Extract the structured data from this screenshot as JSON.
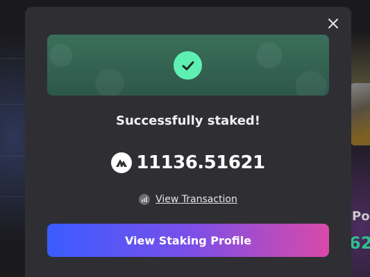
{
  "background": {
    "right_label": "Po",
    "right_value": "62"
  },
  "modal": {
    "close_icon": "close-icon",
    "banner_icon": "check-circle-icon",
    "title": "Successfully staked!",
    "amount": "11136.51621",
    "token_icon": "token-logo-icon",
    "transaction_link": "View Transaction",
    "transaction_icon": "explorer-icon",
    "cta_label": "View Staking Profile"
  },
  "colors": {
    "modal_bg": "#2f2f33",
    "success_green": "#5ef0b2",
    "banner_bg": "#2f5a4c",
    "cta_gradient_start": "#3a5cff",
    "cta_gradient_end": "#d94aa8"
  }
}
